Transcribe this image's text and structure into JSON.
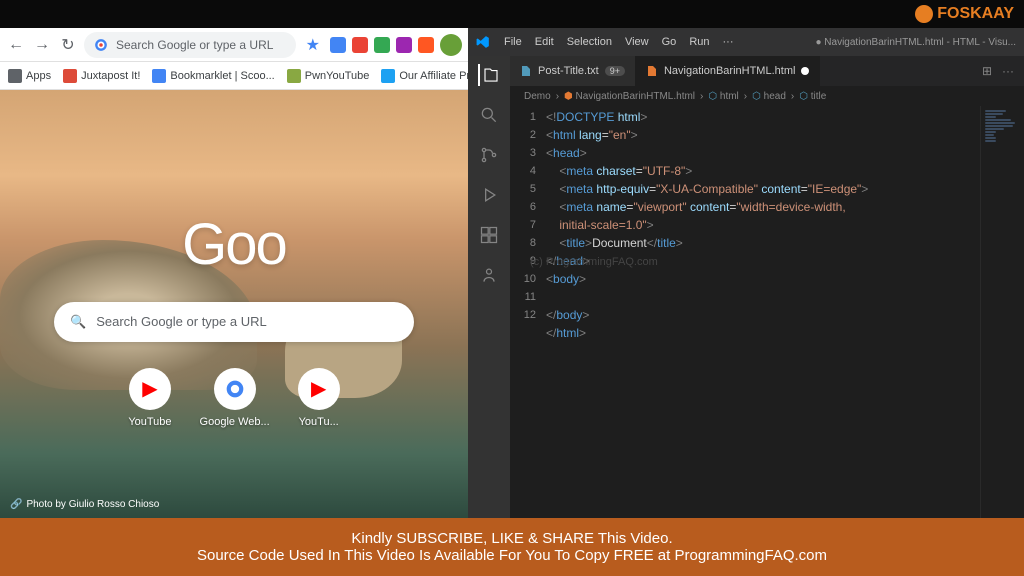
{
  "logo": "FOSKAAY",
  "chrome": {
    "omnibox_placeholder": "Search Google or type a URL",
    "bookmarks": [
      {
        "label": "Apps",
        "icon": "#5f6368"
      },
      {
        "label": "Juxtapost It!",
        "icon": "#dd4b39"
      },
      {
        "label": "Bookmarklet | Scoo...",
        "icon": "#4285f4"
      },
      {
        "label": "PwnYouTube",
        "icon": "#89a842"
      },
      {
        "label": "Our Affiliate Progra...",
        "icon": "#1da1f2"
      }
    ],
    "searchbox_placeholder": "Search Google or type a URL",
    "shortcuts": [
      {
        "label": "YouTube",
        "type": "yt"
      },
      {
        "label": "Google Web...",
        "type": "g"
      },
      {
        "label": "YouTu...",
        "type": "yt"
      }
    ],
    "photo_credit": "Photo by Giulio Rosso Chioso"
  },
  "vscode": {
    "menus": [
      "File",
      "Edit",
      "Selection",
      "View",
      "Go",
      "Run",
      "···"
    ],
    "title": "NavigationBarinHTML.html - HTML - Visu...",
    "tabs": [
      {
        "label": "Post-Title.txt",
        "badge": "9+",
        "icon": "#519aba"
      },
      {
        "label": "NavigationBarinHTML.html",
        "active": true,
        "modified": true,
        "icon": "#e37933"
      }
    ],
    "breadcrumb": [
      "Demo",
      "NavigationBarinHTML.html",
      "html",
      "head",
      "title"
    ],
    "watermark": "(c) ProgrammingFAQ.com",
    "code_lines": [
      1,
      2,
      3,
      4,
      5,
      6,
      "",
      7,
      8,
      9,
      10,
      11,
      12
    ],
    "doc_title": "Document"
  },
  "banner": {
    "line1": "Kindly SUBSCRIBE, LIKE & SHARE This Video.",
    "line2": "Source Code Used In This Video Is Available For You To Copy  FREE at  ProgrammingFAQ.com"
  }
}
